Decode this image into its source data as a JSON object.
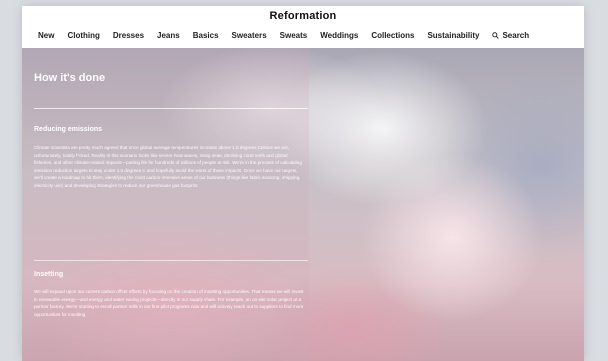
{
  "brand": "Reformation",
  "nav": {
    "items": [
      "New",
      "Clothing",
      "Dresses",
      "Jeans",
      "Basics",
      "Sweaters",
      "Sweats",
      "Weddings",
      "Collections",
      "Sustainability"
    ],
    "search_label": "Search"
  },
  "content": {
    "title": "How it's done",
    "sections": [
      {
        "heading": "Reducing emissions",
        "body": "Climate scientists are pretty much agreed that once global average temperatures increase above 1.5 degrees Celsius we are, unfortunately, totally f*cked. Reality in this scenario looks like severe heat waves, rising seas, declining coral reefs and global fisheries, and other climate-related impacts—putting life for hundreds of millions of people at risk. We're in the process of calculating emission reduction targets to stay under 1.5 degrees C and hopefully avoid the worst of these impacts. Once we have our targets, we'll create a roadmap to hit them, identifying the most carbon-intensive areas of our business (things like fabric sourcing, shipping, electricity use) and developing strategies to reduce our greenhouse gas footprint."
      },
      {
        "heading": "Insetting",
        "body": "We will expand upon our current carbon offset efforts by focusing on the creation of insetting opportunities. That means we will invest in renewable energy—and energy and water saving projects—directly in our supply chain. For example, an on-site solar project at a partner factory. We're starting to enroll partner mills in our first pilot programs now and will actively reach out to suppliers to find more opportunities for insetting."
      }
    ]
  },
  "colors": {
    "nav_bg": "#ffffff",
    "text_on_hero": "#ffffff"
  }
}
